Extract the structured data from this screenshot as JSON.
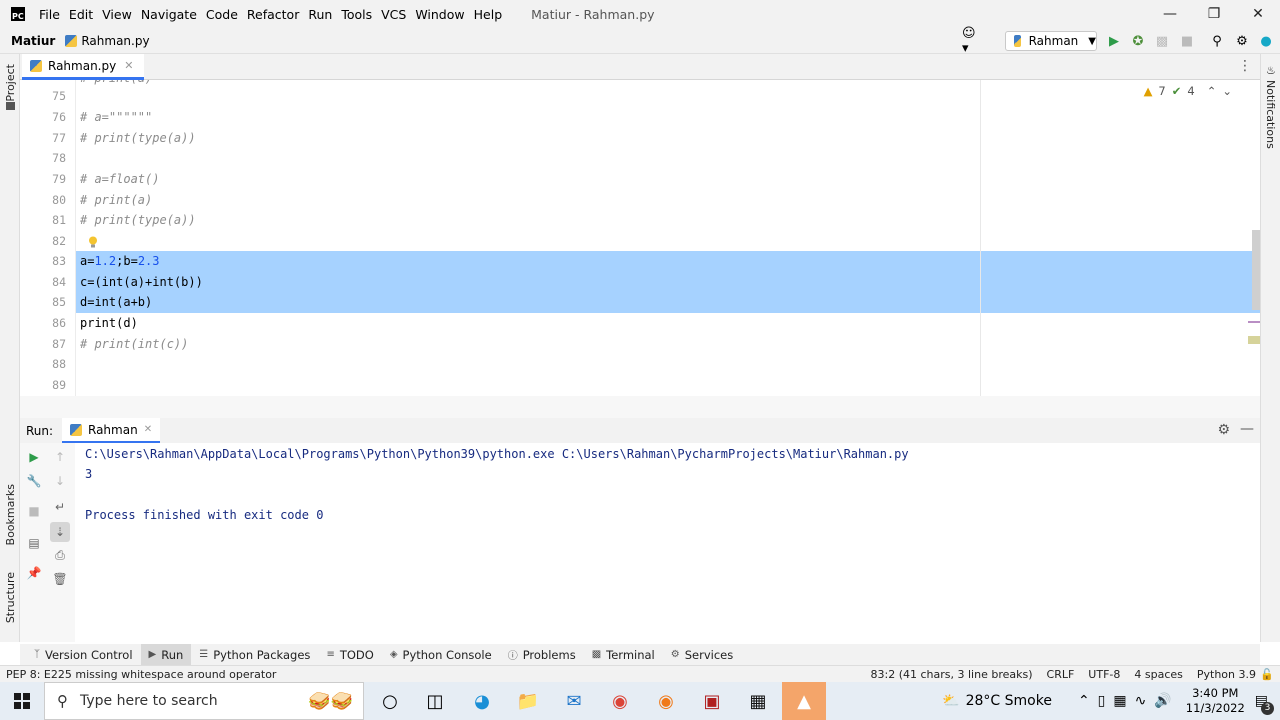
{
  "titlebar": {
    "menu": [
      "File",
      "Edit",
      "View",
      "Navigate",
      "Code",
      "Refactor",
      "Run",
      "Tools",
      "VCS",
      "Window",
      "Help"
    ],
    "window_title": "Matiur - Rahman.py"
  },
  "navbar": {
    "project": "Matiur",
    "file": "Rahman.py",
    "run_config": "Rahman"
  },
  "editor": {
    "tab_label": "Rahman.py",
    "inspections": {
      "warnings": "7",
      "weak_warnings": "4"
    },
    "lines": [
      {
        "n": "75",
        "text": ""
      },
      {
        "n": "76",
        "text": "# a=\"\"\"\"\"\""
      },
      {
        "n": "77",
        "text": "# print(type(a))"
      },
      {
        "n": "78",
        "text": ""
      },
      {
        "n": "79",
        "text": "# a=float()"
      },
      {
        "n": "80",
        "text": "# print(a)"
      },
      {
        "n": "81",
        "text": "# print(type(a))"
      },
      {
        "n": "82",
        "text": ""
      },
      {
        "n": "83",
        "text": "a=1.2;b=2.3"
      },
      {
        "n": "84",
        "text": "c=(int(a)+int(b))"
      },
      {
        "n": "85",
        "text": "d=int(a+b)"
      },
      {
        "n": "86",
        "text": "print(d)"
      },
      {
        "n": "87",
        "text": "# print(int(c))"
      },
      {
        "n": "88",
        "text": ""
      },
      {
        "n": "89",
        "text": ""
      }
    ]
  },
  "run_panel": {
    "label": "Run:",
    "tab": "Rahman",
    "output": [
      "C:\\Users\\Rahman\\AppData\\Local\\Programs\\Python\\Python39\\python.exe C:\\Users\\Rahman\\PycharmProjects\\Matiur\\Rahman.py",
      "3",
      "",
      "Process finished with exit code 0"
    ]
  },
  "side_labels": {
    "project": "Project",
    "bookmarks": "Bookmarks",
    "structure": "Structure",
    "notifications": "Notifications"
  },
  "bottom_tools": [
    "Version Control",
    "Run",
    "Python Packages",
    "TODO",
    "Python Console",
    "Problems",
    "Terminal",
    "Services"
  ],
  "statusbar": {
    "message": "PEP 8: E225 missing whitespace around operator",
    "position": "83:2 (41 chars, 3 line breaks)",
    "line_sep": "CRLF",
    "encoding": "UTF-8",
    "indent": "4 spaces",
    "interpreter": "Python 3.9"
  },
  "taskbar": {
    "search_placeholder": "Type here to search",
    "weather": "28°C  Smoke",
    "time": "3:40 PM",
    "date": "11/3/2022",
    "notif_count": "3"
  },
  "colors": {
    "selection": "#a6d2ff",
    "accent": "#3574f0",
    "comment": "#8c8c8c",
    "number": "#1750eb"
  }
}
